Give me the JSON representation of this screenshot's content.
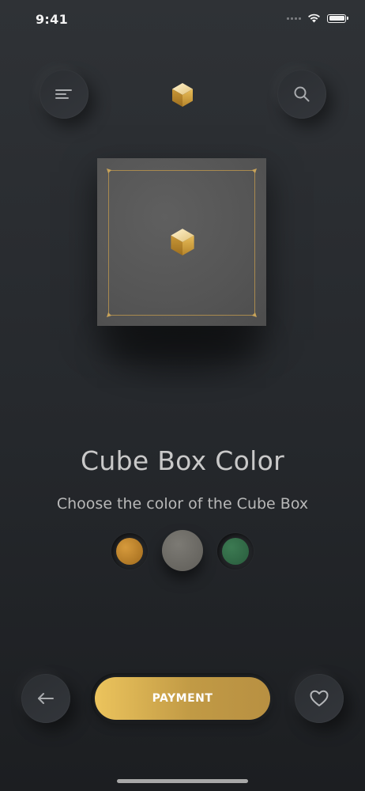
{
  "status_bar": {
    "time": "9:41"
  },
  "header": {
    "menu_icon": "menu-icon",
    "logo_icon": "cube-logo-icon",
    "search_icon": "search-icon"
  },
  "product": {
    "title": "Cube Box Color",
    "subtitle": "Choose the color of the Cube Box"
  },
  "color_options": [
    {
      "name": "gold",
      "hex": "#c0842a",
      "selected": false
    },
    {
      "name": "gray",
      "hex": "#6f6d68",
      "selected": true
    },
    {
      "name": "green",
      "hex": "#336b48",
      "selected": false
    }
  ],
  "footer": {
    "back_icon": "arrow-left-icon",
    "payment_label": "PAYMENT",
    "favorite_icon": "heart-icon"
  },
  "colors": {
    "accent_gold": "#d9b356",
    "background": "#2a2d31"
  }
}
